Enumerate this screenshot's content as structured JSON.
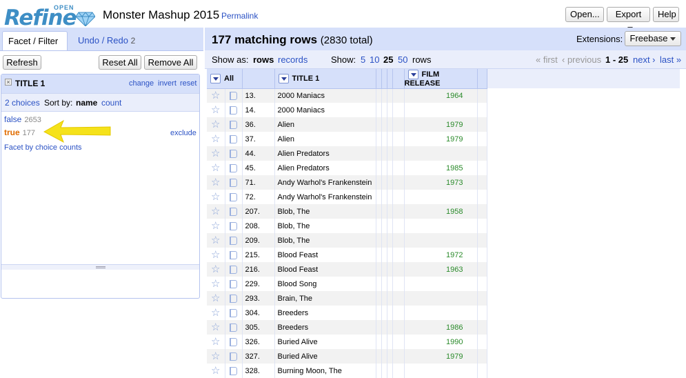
{
  "header": {
    "logo_open": "OPEN",
    "logo_refine": "Refine",
    "project_title": "Monster Mashup 2015",
    "permalink": "Permalink",
    "open_button": "Open...",
    "export_button": "Export",
    "help_button": "Help"
  },
  "left": {
    "tabs": [
      {
        "label": "Facet / Filter"
      },
      {
        "label": "Undo / Redo",
        "count": "2"
      }
    ],
    "refresh": "Refresh",
    "reset_all": "Reset All",
    "remove_all": "Remove All",
    "facet": {
      "title": "TITLE 1",
      "change": "change",
      "invert": "invert",
      "reset": "reset",
      "choices_count": "2 choices",
      "sort_by": "Sort by:",
      "sort_name": "name",
      "sort_count": "count",
      "choices": [
        {
          "label": "false",
          "count": "2653"
        },
        {
          "label": "true",
          "count": "177"
        }
      ],
      "exclude": "exclude",
      "facet_by_counts": "Facet by choice counts"
    }
  },
  "main": {
    "summary": "177 matching rows",
    "summary_total": "(2830 total)",
    "extensions_label": "Extensions:",
    "extensions_button": "Freebase",
    "show_as": "Show as:",
    "mode_rows": "rows",
    "mode_records": "records",
    "show": "Show:",
    "page_sizes": [
      "5",
      "10",
      "25",
      "50"
    ],
    "rows_label": "rows",
    "first": "« first",
    "previous": "‹ previous",
    "range": "1 - 25",
    "next": "next ›",
    "last": "last »",
    "columns": {
      "all": "All",
      "title": "TITLE 1",
      "film": "FILM RELEASE"
    },
    "rows": [
      {
        "idx": "13.",
        "title": "2000 Maniacs",
        "film": "1964"
      },
      {
        "idx": "14.",
        "title": "2000 Maniacs",
        "film": ""
      },
      {
        "idx": "36.",
        "title": "Alien",
        "film": "1979"
      },
      {
        "idx": "37.",
        "title": "Alien",
        "film": "1979"
      },
      {
        "idx": "44.",
        "title": "Alien Predators",
        "film": ""
      },
      {
        "idx": "45.",
        "title": "Alien Predators",
        "film": "1985"
      },
      {
        "idx": "71.",
        "title": "Andy Warhol's Frankenstein",
        "film": "1973"
      },
      {
        "idx": "72.",
        "title": "Andy Warhol's Frankenstein",
        "film": ""
      },
      {
        "idx": "207.",
        "title": "Blob, The",
        "film": "1958"
      },
      {
        "idx": "208.",
        "title": "Blob, The",
        "film": ""
      },
      {
        "idx": "209.",
        "title": "Blob, The",
        "film": ""
      },
      {
        "idx": "215.",
        "title": "Blood Feast",
        "film": "1972"
      },
      {
        "idx": "216.",
        "title": "Blood Feast",
        "film": "1963"
      },
      {
        "idx": "229.",
        "title": "Blood Song",
        "film": ""
      },
      {
        "idx": "293.",
        "title": "Brain, The",
        "film": ""
      },
      {
        "idx": "304.",
        "title": "Breeders",
        "film": ""
      },
      {
        "idx": "305.",
        "title": "Breeders",
        "film": "1986"
      },
      {
        "idx": "326.",
        "title": "Buried Alive",
        "film": "1990"
      },
      {
        "idx": "327.",
        "title": "Buried Alive",
        "film": "1979"
      },
      {
        "idx": "328.",
        "title": "Burning Moon, The",
        "film": ""
      }
    ]
  },
  "colors": {
    "accent": "#2a51c4",
    "panel_bg": "#d6e0fa",
    "choice_true": "#e06c00",
    "year_green": "#2a8a2a",
    "arrow_yellow": "#f5e21a"
  }
}
